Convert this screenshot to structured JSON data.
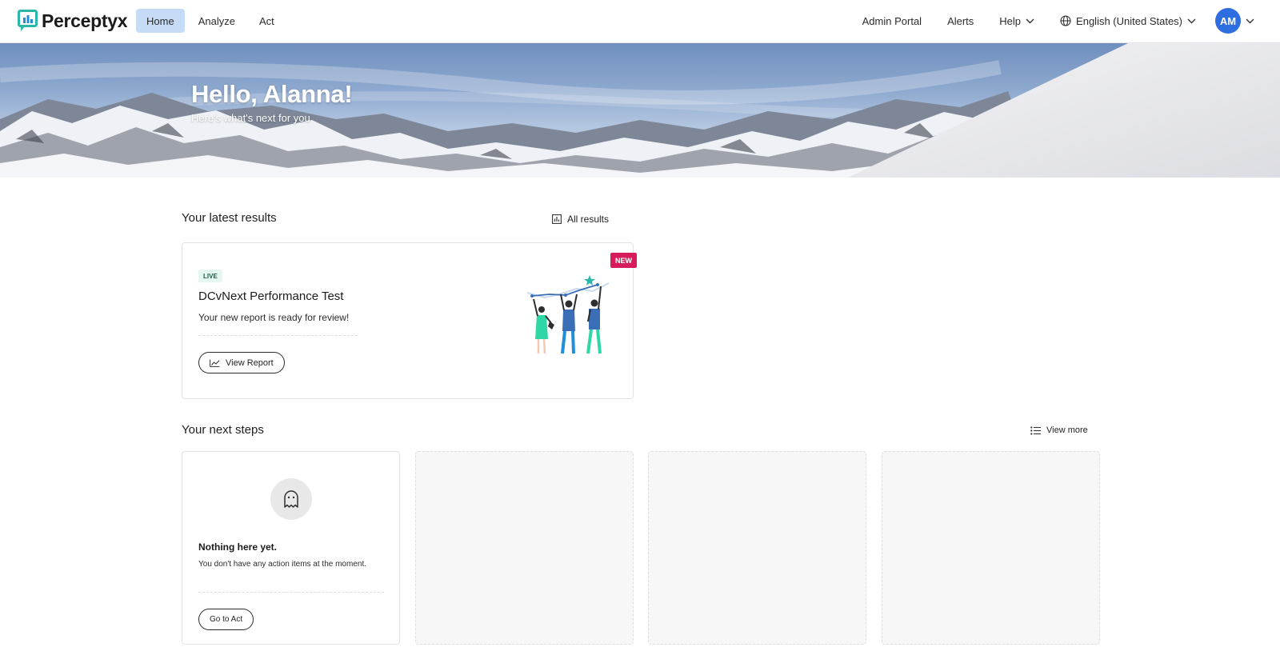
{
  "brand": {
    "name": "Perceptyx"
  },
  "nav": {
    "tabs": [
      {
        "label": "Home",
        "active": true
      },
      {
        "label": "Analyze",
        "active": false
      },
      {
        "label": "Act",
        "active": false
      }
    ],
    "right": {
      "admin_portal": "Admin Portal",
      "alerts": "Alerts",
      "help": "Help",
      "language": "English (United States)",
      "avatar_initials": "AM"
    }
  },
  "hero": {
    "title": "Hello, Alanna!",
    "subtitle": "Here's what's next for you"
  },
  "latest_results": {
    "title": "Your latest results",
    "all_results_label": "All results",
    "card": {
      "badge": "NEW",
      "status": "LIVE",
      "title": "DCvNext Performance Test",
      "description": "Your new report is ready for review!",
      "button_label": "View Report"
    }
  },
  "next_steps": {
    "title": "Your next steps",
    "view_more_label": "View more",
    "empty_state": {
      "title": "Nothing here yet.",
      "description": "You don't have any action items at the moment.",
      "button_label": "Go to Act"
    }
  },
  "colors": {
    "accent": "#2f6ee0",
    "active_tab": "#c5dbf6",
    "new_badge": "#d81b5c",
    "live_tag_bg": "#e5f7f1",
    "logo_teal": "#2ab7a9",
    "logo_blue": "#1f8fd8"
  },
  "icons": [
    "logo-icon",
    "chevron-down-icon",
    "globe-icon",
    "bar-chart-icon",
    "trend-line-icon",
    "list-icon",
    "ghost-icon"
  ]
}
